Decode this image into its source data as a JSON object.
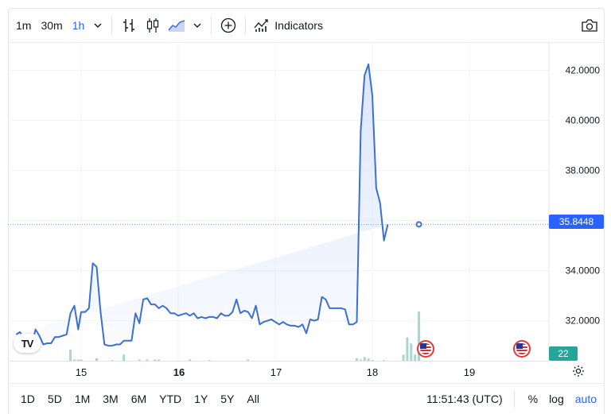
{
  "toolbar": {
    "intervals": [
      "1m",
      "30m",
      "1h"
    ],
    "active_interval": "1h",
    "indicators_label": "Indicators"
  },
  "chart_data": {
    "type": "area",
    "x": [
      14.33,
      14.37,
      14.41,
      14.45,
      14.49,
      14.53,
      14.57,
      14.61,
      14.65,
      14.69,
      14.73,
      14.77,
      14.81,
      14.85,
      14.89,
      14.93,
      14.97,
      15.0,
      15.04,
      15.08,
      15.12,
      15.16,
      15.2,
      15.24,
      15.28,
      15.32,
      15.36,
      15.4,
      15.44,
      15.48,
      15.52,
      15.56,
      15.6,
      15.64,
      15.68,
      15.72,
      15.76,
      15.8,
      15.84,
      15.88,
      15.92,
      15.96,
      16.0,
      16.04,
      16.08,
      16.12,
      16.16,
      16.2,
      16.24,
      16.28,
      16.32,
      16.36,
      16.4,
      16.44,
      16.48,
      16.52,
      16.56,
      16.6,
      16.64,
      16.68,
      16.72,
      16.76,
      16.8,
      16.84,
      16.88,
      16.92,
      16.96,
      17.0,
      17.04,
      17.08,
      17.12,
      17.16,
      17.2,
      17.24,
      17.28,
      17.32,
      17.36,
      17.4,
      17.44,
      17.48,
      17.52,
      17.56,
      17.6,
      17.64,
      17.68,
      17.72,
      17.76,
      17.8,
      17.84,
      17.88,
      17.92,
      17.96,
      18.0,
      18.04,
      18.08,
      18.12,
      18.16,
      18.2,
      18.24,
      18.28,
      18.32,
      18.36,
      18.4,
      18.44,
      18.48
    ],
    "y": [
      31.45,
      31.55,
      31.25,
      31.05,
      31.05,
      31.65,
      31.4,
      31.05,
      31.1,
      31.1,
      31.35,
      31.35,
      31.4,
      31.45,
      32.3,
      32.6,
      31.65,
      32.35,
      32.35,
      32.5,
      34.3,
      34.15,
      32.35,
      31.05,
      31.0,
      31.0,
      31.05,
      31.05,
      31.2,
      31.2,
      31.2,
      32.3,
      31.9,
      32.85,
      32.9,
      32.65,
      32.65,
      32.5,
      32.6,
      32.5,
      32.3,
      32.3,
      32.2,
      32.25,
      32.3,
      32.2,
      32.3,
      32.1,
      32.15,
      32.1,
      32.15,
      32.15,
      32.1,
      32.3,
      32.2,
      32.2,
      32.35,
      32.85,
      32.3,
      32.4,
      32.35,
      32.1,
      32.6,
      31.85,
      31.95,
      32.0,
      32.05,
      31.95,
      31.85,
      31.95,
      31.85,
      31.8,
      31.8,
      31.75,
      31.85,
      31.5,
      32.05,
      32.0,
      32.05,
      32.95,
      32.85,
      32.5,
      32.5,
      32.5,
      32.5,
      32.45,
      31.85,
      31.85,
      31.95,
      39.6,
      41.8,
      42.25,
      41.0,
      37.3,
      36.7,
      35.2,
      35.85
    ],
    "volume": [
      0,
      0,
      0,
      0,
      0,
      0,
      0,
      0,
      0,
      0,
      0,
      0,
      0,
      0,
      0.9,
      0.1,
      0.1,
      0.1,
      0,
      0,
      0,
      0.2,
      0,
      0,
      0,
      0.05,
      0,
      0,
      0.5,
      0,
      0,
      0,
      0.1,
      0,
      0.1,
      0,
      0.1,
      0.1,
      0,
      0,
      0,
      0,
      0,
      0,
      0,
      0.1,
      0,
      0,
      0,
      0,
      0.05,
      0,
      0,
      0,
      0,
      0,
      0,
      0,
      0,
      0,
      0.1,
      0,
      0,
      0,
      0,
      0,
      0,
      0,
      0,
      0,
      0,
      0,
      0,
      0,
      0,
      0,
      0,
      0,
      0,
      0,
      0,
      0,
      0,
      0,
      0,
      0,
      0,
      0,
      0.2,
      0.1,
      0.3,
      0.2,
      0.05,
      0,
      0,
      0.05,
      0,
      0,
      0,
      0,
      0.5,
      1.9,
      1.4,
      0.5,
      4.0,
      2.9,
      1.5,
      0.6,
      0.6,
      0.3
    ],
    "x_ticks": [
      "15",
      "16",
      "17",
      "18",
      "19"
    ],
    "y_ticks": [
      "32.0000",
      "34.0000",
      "36.0000",
      "38.0000",
      "40.0000",
      "42.0000"
    ],
    "ylim": [
      30.4,
      43.1
    ],
    "xlim": [
      14.33,
      19.72
    ],
    "last_price": "35.8448",
    "volume_label": "22",
    "line_color": "#3b6fd4",
    "area_color": "#d7e3fb",
    "vol_up_color": "#a6d8cf",
    "vol_down_color": "#f2b5ae"
  },
  "bottom": {
    "ranges": [
      "1D",
      "5D",
      "1M",
      "3M",
      "6M",
      "YTD",
      "1Y",
      "5Y",
      "All"
    ],
    "time": "11:51:43 (UTC)",
    "modes": [
      "%",
      "log",
      "auto"
    ],
    "active_mode": "auto"
  },
  "icons": {
    "bars": "bar-chart-icon",
    "candles": "candlestick-icon",
    "area": "area-chart-icon",
    "add": "add-compare-icon",
    "indicators": "indicators-icon",
    "camera": "screenshot-camera-icon",
    "settings": "gear-icon",
    "logo": "tradingview-logo",
    "event": "us-flag-event-icon"
  }
}
